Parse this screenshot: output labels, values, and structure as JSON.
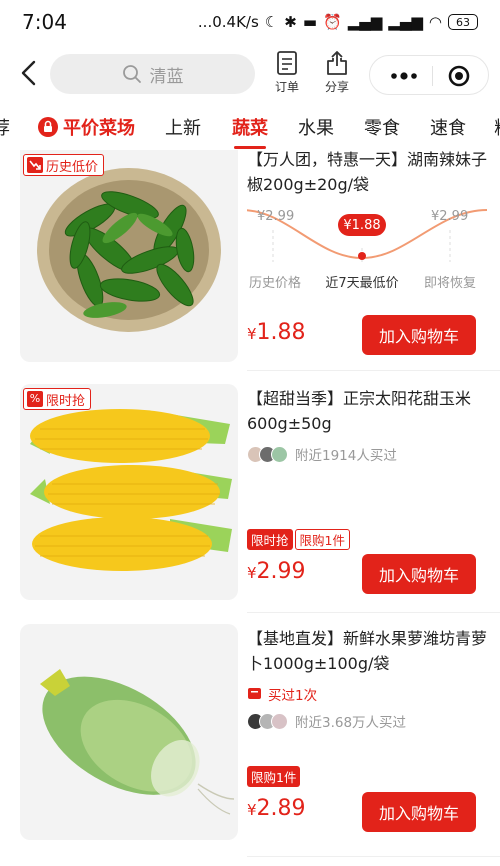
{
  "status_bar": {
    "time": "7:04",
    "network_speed": "...0.4K/s",
    "battery": "63"
  },
  "header": {
    "search_placeholder": "清蓝",
    "orders_label": "订单",
    "share_label": "分享"
  },
  "tabs": [
    {
      "label": "荐"
    },
    {
      "label": "平价菜场"
    },
    {
      "label": "上新"
    },
    {
      "label": "蔬菜"
    },
    {
      "label": "水果"
    },
    {
      "label": "零食"
    },
    {
      "label": "速食"
    },
    {
      "label": "粮"
    }
  ],
  "active_tab": "蔬菜",
  "products": [
    {
      "badge": "历史低价",
      "title": "【万人团，特惠一天】湖南辣妹子椒200g±20g/袋",
      "trend": {
        "history_price": "¥2.99",
        "low_price": "¥1.88",
        "restore_price": "¥2.99",
        "history_label": "历史价格",
        "low_label": "近7天最低价",
        "restore_label": "即将恢复"
      },
      "price": "1.88",
      "cart_label": "加入购物车"
    },
    {
      "badge": "限时抢",
      "title": "【超甜当季】正宗太阳花甜玉米600g±50g",
      "social": "附近1914人买过",
      "tags": [
        "限时抢",
        "限购1件"
      ],
      "price": "2.99",
      "cart_label": "加入购物车"
    },
    {
      "title": "【基地直发】新鲜水果萝潍坊青萝卜1000g±100g/袋",
      "bought": "买过1次",
      "social": "附近3.68万人买过",
      "tags": [
        "限购1件"
      ],
      "price": "2.89",
      "cart_label": "加入购物车"
    }
  ],
  "currency_symbol": "¥",
  "colors": {
    "accent": "#e2231a",
    "muted": "#999999",
    "search_bg": "#ededed"
  }
}
